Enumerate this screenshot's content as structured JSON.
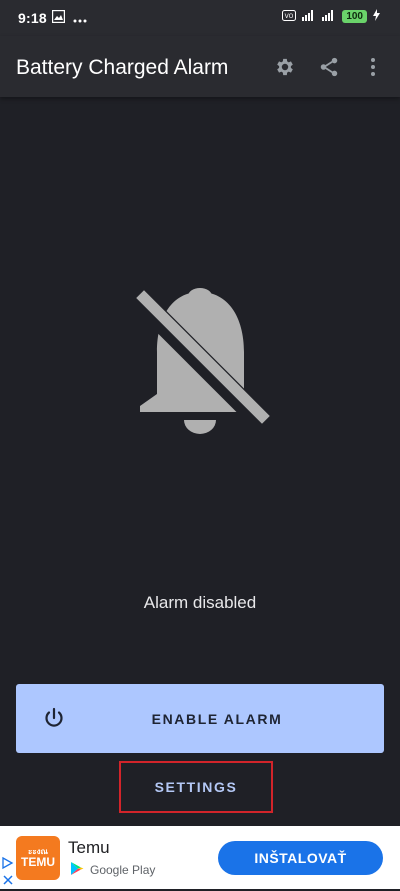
{
  "status_bar": {
    "time": "9:18",
    "battery_level": "100",
    "left_icons": [
      "photo-icon",
      "more-dots-icon"
    ],
    "right_icons": [
      "volte-icon",
      "signal-4g-icon",
      "wifi-icon",
      "battery-icon",
      "charging-bolt-icon"
    ],
    "accent_battery": "#6ad36a"
  },
  "app_bar": {
    "title": "Battery Charged Alarm",
    "actions": [
      "settings-gear-icon",
      "share-icon",
      "overflow-menu-icon"
    ]
  },
  "main": {
    "status_icon": "bell-off-icon",
    "status_text": "Alarm disabled",
    "enable_button": {
      "label": "ENABLE ALARM",
      "icon": "power-icon",
      "color": "#adc7ff"
    },
    "settings_button": {
      "label": "SETTINGS",
      "highlight_color": "#d2242a"
    }
  },
  "ad": {
    "app_name": "Temu",
    "logo_text_top": "ะะงณ",
    "logo_text": "TEMU",
    "store": "Google Play",
    "install_label": "INŠTALOVAŤ",
    "install_color": "#1a73e8"
  }
}
